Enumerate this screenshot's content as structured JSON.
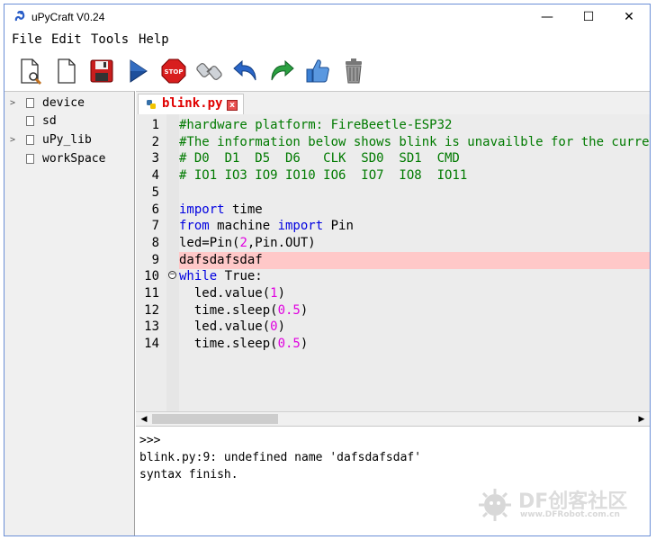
{
  "window": {
    "title": "uPyCraft V0.24",
    "minimize": "—",
    "maximize": "☐",
    "close": "✕"
  },
  "menu": {
    "items": [
      "File",
      "Edit",
      "Tools",
      "Help"
    ]
  },
  "toolbar": {
    "icons": [
      "new-file-icon",
      "open-file-icon",
      "save-icon",
      "run-icon",
      "stop-icon",
      "connect-icon",
      "undo-icon",
      "redo-icon",
      "syntax-check-icon",
      "clear-icon"
    ]
  },
  "sidebar": {
    "items": [
      {
        "label": "device",
        "expandable": true
      },
      {
        "label": "sd",
        "expandable": false
      },
      {
        "label": "uPy_lib",
        "expandable": true
      },
      {
        "label": "workSpace",
        "expandable": false
      }
    ]
  },
  "tab": {
    "label": "blink.py",
    "close": "x"
  },
  "editor": {
    "error_line": 9,
    "lines": [
      {
        "n": "1",
        "parts": [
          [
            "c",
            "#hardware platform: FireBeetle-ESP32"
          ]
        ]
      },
      {
        "n": "2",
        "parts": [
          [
            "c",
            "#The information below shows blink is unavailble for the curre"
          ]
        ]
      },
      {
        "n": "3",
        "parts": [
          [
            "c",
            "# D0  D1  D5  D6   CLK  SD0  SD1  CMD"
          ]
        ]
      },
      {
        "n": "4",
        "parts": [
          [
            "c",
            "# IO1 IO3 IO9 IO10 IO6  IO7  IO8  IO11"
          ]
        ]
      },
      {
        "n": "5",
        "parts": [
          [
            "t",
            ""
          ]
        ]
      },
      {
        "n": "6",
        "parts": [
          [
            "k",
            "import"
          ],
          [
            "t",
            " time"
          ]
        ]
      },
      {
        "n": "7",
        "parts": [
          [
            "k",
            "from"
          ],
          [
            "t",
            " machine "
          ],
          [
            "k",
            "import"
          ],
          [
            "t",
            " Pin"
          ]
        ]
      },
      {
        "n": "8",
        "parts": [
          [
            "t",
            "led=Pin("
          ],
          [
            "d",
            "2"
          ],
          [
            "t",
            ",Pin.OUT)"
          ]
        ]
      },
      {
        "n": "9",
        "parts": [
          [
            "t",
            "dafsdafsdaf"
          ]
        ]
      },
      {
        "n": "10",
        "parts": [
          [
            "k",
            "while"
          ],
          [
            "t",
            " True:"
          ]
        ]
      },
      {
        "n": "11",
        "parts": [
          [
            "t",
            "  led.value("
          ],
          [
            "d",
            "1"
          ],
          [
            "t",
            ")"
          ]
        ]
      },
      {
        "n": "12",
        "parts": [
          [
            "t",
            "  time.sleep("
          ],
          [
            "d",
            "0.5"
          ],
          [
            "t",
            ")"
          ]
        ]
      },
      {
        "n": "13",
        "parts": [
          [
            "t",
            "  led.value("
          ],
          [
            "d",
            "0"
          ],
          [
            "t",
            ")"
          ]
        ]
      },
      {
        "n": "14",
        "parts": [
          [
            "t",
            "  time.sleep("
          ],
          [
            "d",
            "0.5"
          ],
          [
            "t",
            ")"
          ]
        ]
      }
    ]
  },
  "scrollbar": {
    "left": "◀",
    "right": "▶"
  },
  "terminal": {
    "lines": [
      ">>>",
      "blink.py:9: undefined name 'dafsdafsdaf'",
      "syntax finish."
    ]
  },
  "watermark": {
    "brand": "DF创客社区",
    "url": "www.DFRobot.com.cn"
  }
}
